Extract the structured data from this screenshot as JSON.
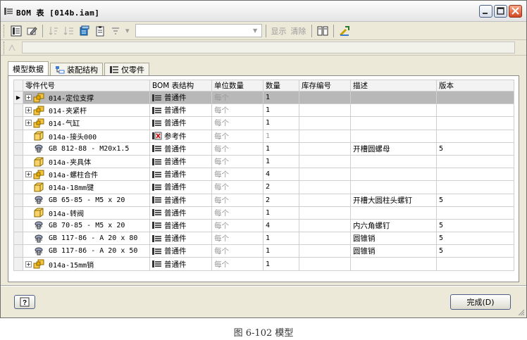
{
  "window": {
    "title": "BOM 表 [014b.iam]"
  },
  "toolbar": {
    "show_label": "显示",
    "clear_label": "清除"
  },
  "tabs": [
    {
      "label": "模型数据"
    },
    {
      "label": "装配结构"
    },
    {
      "label": "仅零件"
    }
  ],
  "table": {
    "headers": [
      "零件代号",
      "BOM 表结构",
      "单位数量",
      "数量",
      "库存编号",
      "描述",
      "版本"
    ],
    "rows": [
      {
        "part": "014-定位支撑",
        "icon": "assembly-icon",
        "expand": "+",
        "struct": "普通件",
        "unit": "每个",
        "qty": "1",
        "stock": "",
        "desc": "",
        "rev": ""
      },
      {
        "part": "014-夹紧杆",
        "icon": "assembly-icon",
        "expand": "+",
        "struct": "普通件",
        "unit": "每个",
        "qty": "1",
        "stock": "",
        "desc": "",
        "rev": ""
      },
      {
        "part": "014-气缸",
        "icon": "assembly-icon",
        "expand": "+",
        "struct": "普通件",
        "unit": "每个",
        "qty": "1",
        "stock": "",
        "desc": "",
        "rev": ""
      },
      {
        "part": "014a-接头000",
        "icon": "part-icon",
        "expand": "",
        "struct": "参考件",
        "unit": "每个",
        "qty": "1",
        "stock": "",
        "desc": "",
        "rev": ""
      },
      {
        "part": "GB 812-88 - M20x1.5",
        "icon": "standard-part-icon",
        "expand": "",
        "struct": "普通件",
        "unit": "每个",
        "qty": "1",
        "stock": "",
        "desc": "开槽圆螺母",
        "rev": "5"
      },
      {
        "part": "014a-夹具体",
        "icon": "part-icon",
        "expand": "",
        "struct": "普通件",
        "unit": "每个",
        "qty": "1",
        "stock": "",
        "desc": "",
        "rev": ""
      },
      {
        "part": "014a-螺柱合件",
        "icon": "assembly-icon",
        "expand": "+",
        "struct": "普通件",
        "unit": "每个",
        "qty": "4",
        "stock": "",
        "desc": "",
        "rev": ""
      },
      {
        "part": "014a-18mm键",
        "icon": "part-icon",
        "expand": "",
        "struct": "普通件",
        "unit": "每个",
        "qty": "2",
        "stock": "",
        "desc": "",
        "rev": ""
      },
      {
        "part": "GB 65-85 - M5 x 20",
        "icon": "standard-part-icon",
        "expand": "",
        "struct": "普通件",
        "unit": "每个",
        "qty": "2",
        "stock": "",
        "desc": "开槽大圆柱头螺钉",
        "rev": "5"
      },
      {
        "part": "014a-转阀",
        "icon": "part-icon",
        "expand": "",
        "struct": "普通件",
        "unit": "每个",
        "qty": "1",
        "stock": "",
        "desc": "",
        "rev": ""
      },
      {
        "part": "GB 70-85 - M5 x 20",
        "icon": "standard-part-icon",
        "expand": "",
        "struct": "普通件",
        "unit": "每个",
        "qty": "4",
        "stock": "",
        "desc": "内六角螺钉",
        "rev": "5"
      },
      {
        "part": "GB 117-86 - A 20 x 80",
        "icon": "standard-part-icon",
        "expand": "",
        "struct": "普通件",
        "unit": "每个",
        "qty": "1",
        "stock": "",
        "desc": "圆锥销",
        "rev": "5"
      },
      {
        "part": "GB 117-86 - A 20 x 50",
        "icon": "standard-part-icon",
        "expand": "",
        "struct": "普通件",
        "unit": "每个",
        "qty": "1",
        "stock": "",
        "desc": "圆锥销",
        "rev": "5"
      },
      {
        "part": "014a-15mm销",
        "icon": "assembly-icon",
        "expand": "+",
        "struct": "普通件",
        "unit": "每个",
        "qty": "1",
        "stock": "",
        "desc": "",
        "rev": ""
      }
    ]
  },
  "buttons": {
    "help": "?",
    "done": "完成(D)"
  },
  "caption": "图 6-102  模型"
}
